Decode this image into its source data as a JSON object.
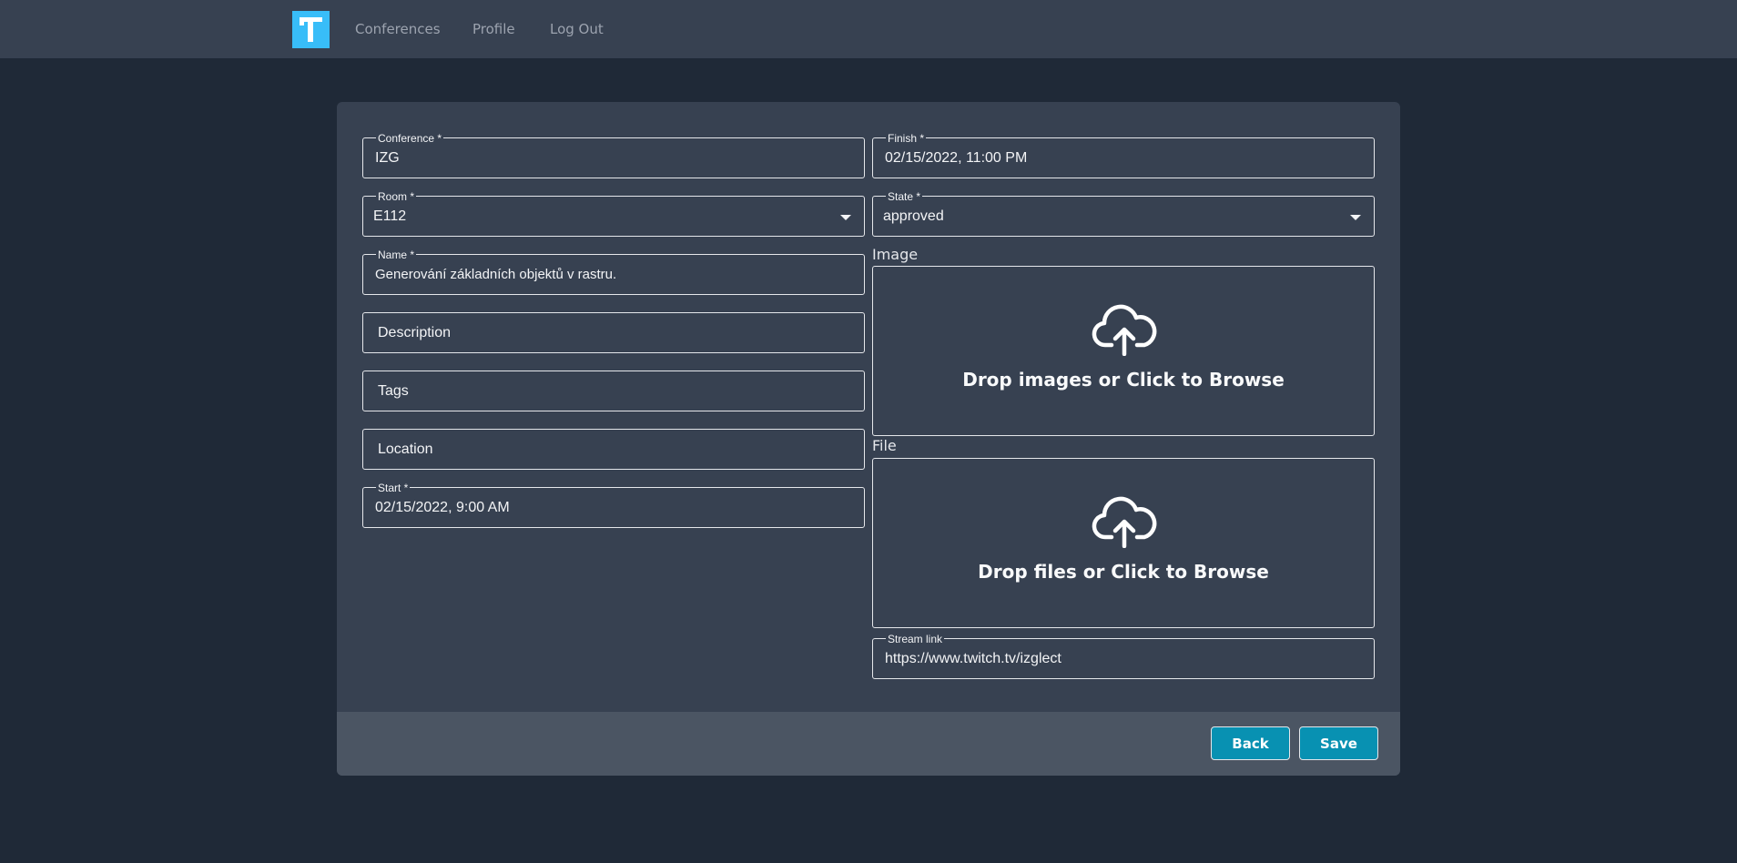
{
  "nav": {
    "links": [
      {
        "label": "Conferences"
      },
      {
        "label": "Profile"
      },
      {
        "label": "Log Out"
      }
    ]
  },
  "form": {
    "conference": {
      "label": "Conference *",
      "value": "IZG"
    },
    "room": {
      "label": "Room *",
      "value": "E112"
    },
    "name": {
      "label": "Name *",
      "value": "Generování základních objektů v rastru."
    },
    "description": {
      "placeholder": "Description"
    },
    "tags": {
      "placeholder": "Tags"
    },
    "location": {
      "placeholder": "Location"
    },
    "start": {
      "label": "Start *",
      "value": "02/15/2022, 9:00 AM"
    },
    "finish": {
      "label": "Finish *",
      "value": "02/15/2022, 11:00 PM"
    },
    "state": {
      "label": "State *",
      "value": "approved"
    },
    "image": {
      "title": "Image",
      "drop_text": "Drop images or Click to Browse"
    },
    "file": {
      "title": "File",
      "drop_text": "Drop files or Click to Browse"
    },
    "stream_link": {
      "label": "Stream link",
      "value": "https://www.twitch.tv/izglect"
    }
  },
  "footer": {
    "back_label": "Back",
    "save_label": "Save"
  },
  "colors": {
    "background": "#1f2937",
    "panel": "#374151",
    "footer": "#4b5563",
    "logo": "#38bdf8",
    "button": "#0891b2"
  },
  "icons": {
    "logo": "t-logo-icon",
    "upload": "cloud-upload-icon",
    "dropdown": "chevron-down-icon"
  }
}
